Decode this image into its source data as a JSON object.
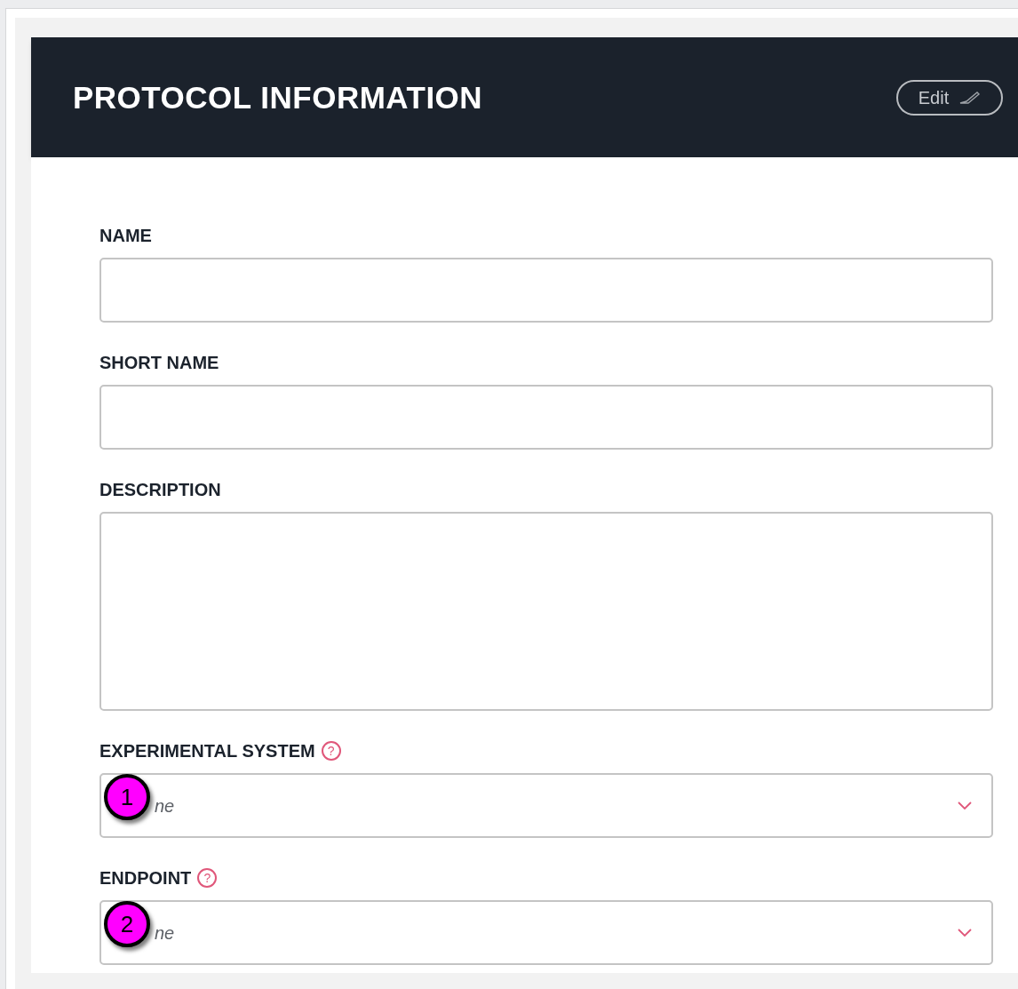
{
  "header": {
    "title": "PROTOCOL INFORMATION",
    "edit_button": "Edit"
  },
  "fields": [
    {
      "kind": "text",
      "label": "NAME"
    },
    {
      "kind": "text",
      "label": "SHORT NAME"
    },
    {
      "kind": "textarea",
      "label": "DESCRIPTION"
    },
    {
      "kind": "select",
      "label": "EXPERIMENTAL SYSTEM",
      "help": "?",
      "placeholder": "ne",
      "callout": "1"
    },
    {
      "kind": "select",
      "label": "ENDPOINT",
      "help": "?",
      "placeholder": "ne",
      "callout": "2"
    }
  ]
}
